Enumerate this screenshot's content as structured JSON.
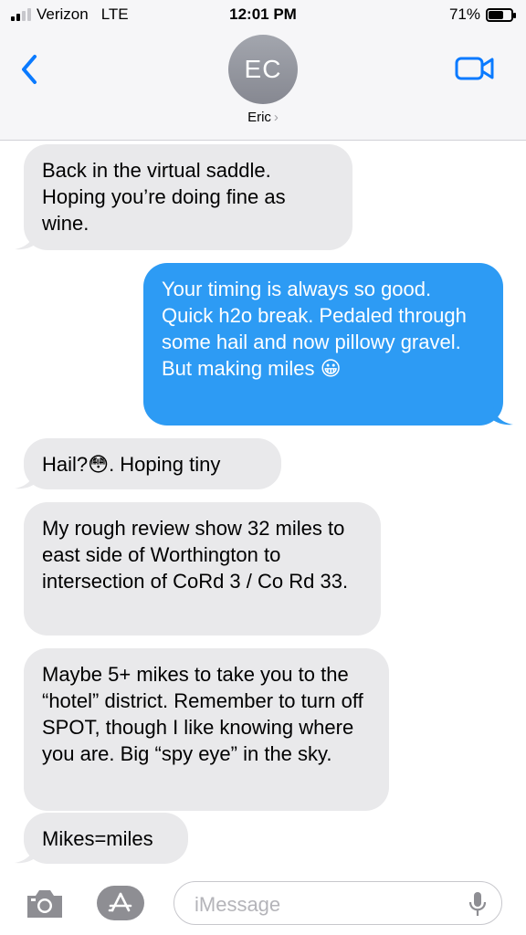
{
  "status_bar": {
    "carrier": "Verizon",
    "network": "LTE",
    "time": "12:01 PM",
    "battery_percent_text": "71%",
    "battery_level": 0.71,
    "signal_bars_filled": 2
  },
  "header": {
    "avatar_initials": "EC",
    "contact_name": "Eric",
    "contact_chevron": "›",
    "back_icon": "chevron-left-icon",
    "video_icon": "video-camera-icon"
  },
  "messages": [
    {
      "direction": "received",
      "text": "Back in the virtual saddle. Hoping you’re doing fine as wine."
    },
    {
      "direction": "sent",
      "text": "Your timing is always so good. Quick h2o break. Pedaled through some hail and now pillowy gravel. But making miles 😀"
    },
    {
      "direction": "received",
      "text": "Hail?😳. Hoping tiny"
    },
    {
      "direction": "received",
      "text": "My rough review show 32 miles to east side of Worthington to intersection of CoRd 3 / Co Rd 33."
    },
    {
      "direction": "received",
      "text": "Maybe 5+ mikes to take you to the “hotel” district. Remember to turn off SPOT, though I like knowing where you are. Big “spy eye” in the sky."
    },
    {
      "direction": "received",
      "text": "Mikes=miles"
    }
  ],
  "composer": {
    "placeholder": "iMessage",
    "camera_icon": "camera-icon",
    "apps_icon": "app-store-icon",
    "mic_icon": "microphone-icon"
  },
  "colors": {
    "sent_bubble": "#2d9bf4",
    "received_bubble": "#e9e9eb",
    "accent": "#0a7aff"
  }
}
